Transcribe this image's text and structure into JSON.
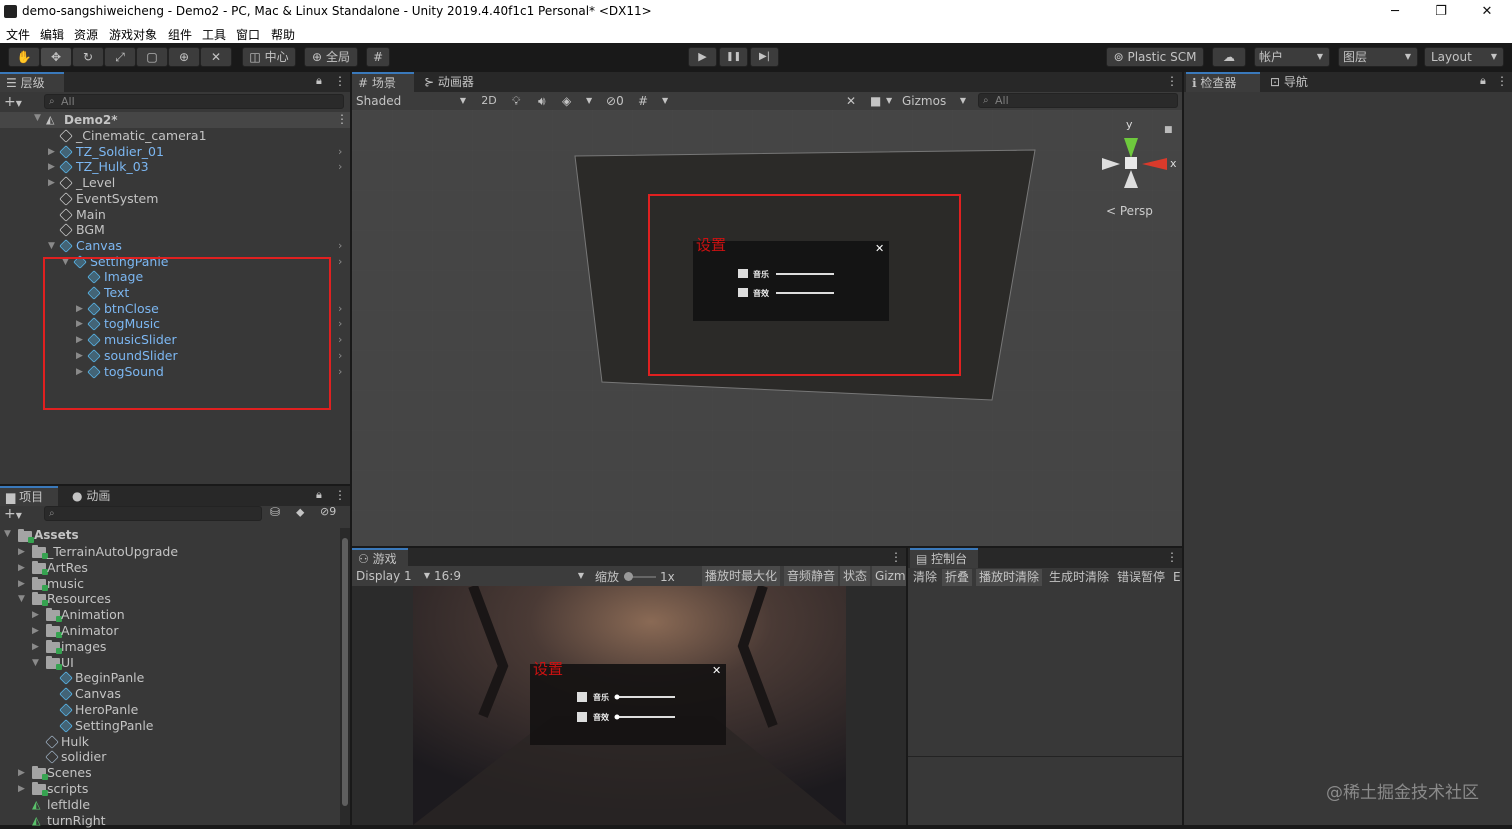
{
  "window": {
    "title": "demo-sangshiweicheng - Demo2 - PC, Mac & Linux Standalone - Unity 2019.4.40f1c1 Personal* <DX11>",
    "minimize": "─",
    "maximize": "❐",
    "close": "✕"
  },
  "menu": [
    "文件",
    "编辑",
    "资源",
    "游戏对象",
    "组件",
    "工具",
    "窗口",
    "帮助"
  ],
  "toolbar": {
    "pivot": "中心",
    "global": "全局",
    "play": "▶",
    "pause": "❚❚",
    "step": "▶|",
    "plastic": "Plastic SCM",
    "account": "帐户",
    "layers": "图层",
    "layout": "Layout"
  },
  "hierarchy": {
    "tab": "层级",
    "search_placeholder": "All",
    "scene": "Demo2*",
    "items": [
      {
        "label": "_Cinematic_camera1",
        "arrow": "",
        "prefab": false
      },
      {
        "label": "TZ_Soldier_01",
        "arrow": "▶",
        "prefab": true
      },
      {
        "label": "TZ_Hulk_03",
        "arrow": "▶",
        "prefab": true
      },
      {
        "label": "_Level",
        "arrow": "▶",
        "prefab": false
      },
      {
        "label": "EventSystem",
        "arrow": "",
        "prefab": false
      },
      {
        "label": "Main",
        "arrow": "",
        "prefab": false
      },
      {
        "label": "BGM",
        "arrow": "",
        "prefab": false
      },
      {
        "label": "Canvas",
        "arrow": "▼",
        "prefab": true
      },
      {
        "label": "SettingPanle",
        "arrow": "▼",
        "prefab": true
      },
      {
        "label": "Image",
        "arrow": "",
        "prefab": true
      },
      {
        "label": "Text",
        "arrow": "",
        "prefab": true
      },
      {
        "label": "btnClose",
        "arrow": "▶",
        "prefab": true
      },
      {
        "label": "togMusic",
        "arrow": "▶",
        "prefab": true
      },
      {
        "label": "musicSlider",
        "arrow": "▶",
        "prefab": true
      },
      {
        "label": "soundSlider",
        "arrow": "▶",
        "prefab": true
      },
      {
        "label": "togSound",
        "arrow": "▶",
        "prefab": true
      }
    ]
  },
  "scene": {
    "tab_scene": "场景",
    "tab_animator": "动画器",
    "shading": "Shaded",
    "mode2d": "2D",
    "hidden_count": "0",
    "gizmos": "Gizmos",
    "search_placeholder": "All",
    "persp": "Persp",
    "axis_x": "x",
    "axis_y": "y"
  },
  "ui_panel": {
    "title": "设置",
    "music": "音乐",
    "sound": "音效",
    "close": "✕"
  },
  "inspector": {
    "tab_inspector": "检查器",
    "tab_navigation": "导航"
  },
  "project": {
    "tab_project": "项目",
    "tab_animation": "动画",
    "hidden_count": "9",
    "root": "Assets",
    "items": [
      {
        "label": "_TerrainAutoUpgrade",
        "arrow": "▶",
        "type": "folder"
      },
      {
        "label": "ArtRes",
        "arrow": "▶",
        "type": "folder"
      },
      {
        "label": "music",
        "arrow": "▶",
        "type": "folder"
      },
      {
        "label": "Resources",
        "arrow": "▼",
        "type": "folder"
      },
      {
        "label": "Animation",
        "arrow": "▶",
        "type": "folder"
      },
      {
        "label": "Animator",
        "arrow": "▶",
        "type": "folder"
      },
      {
        "label": "images",
        "arrow": "▶",
        "type": "folder"
      },
      {
        "label": "UI",
        "arrow": "▼",
        "type": "folder"
      },
      {
        "label": "BeginPanle",
        "arrow": "",
        "type": "prefab"
      },
      {
        "label": "Canvas",
        "arrow": "",
        "type": "prefab"
      },
      {
        "label": "HeroPanle",
        "arrow": "",
        "type": "prefab"
      },
      {
        "label": "SettingPanle",
        "arrow": "",
        "type": "prefab"
      },
      {
        "label": "Hulk",
        "arrow": "",
        "type": "model"
      },
      {
        "label": "solidier",
        "arrow": "",
        "type": "model"
      },
      {
        "label": "Scenes",
        "arrow": "▶",
        "type": "folder"
      },
      {
        "label": "scripts",
        "arrow": "▶",
        "type": "folder"
      },
      {
        "label": "leftIdle",
        "arrow": "",
        "type": "anim"
      },
      {
        "label": "turnRight",
        "arrow": "",
        "type": "anim"
      }
    ]
  },
  "game": {
    "tab": "游戏",
    "display": "Display 1",
    "aspect": "16:9",
    "scale_label": "缩放",
    "scale_value": "1x",
    "maximize": "播放时最大化",
    "mute": "音频静音",
    "stats": "状态",
    "gizmos": "Gizmo"
  },
  "console": {
    "tab": "控制台",
    "clear": "清除",
    "collapse": "折叠",
    "clear_on_play": "播放时清除",
    "clear_on_build": "生成时清除",
    "error_pause": "错误暂停",
    "editor": "E"
  },
  "watermark": "@稀土掘金技术社区"
}
